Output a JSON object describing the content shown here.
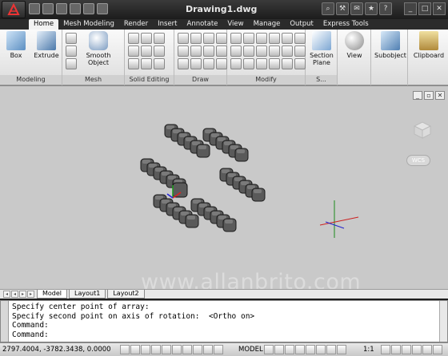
{
  "title": "Drawing1.dwg",
  "ribbon_tabs": [
    "Home",
    "Mesh Modeling",
    "Render",
    "Insert",
    "Annotate",
    "View",
    "Manage",
    "Output",
    "Express Tools"
  ],
  "ribbon": {
    "box_label": "Box",
    "extrude_label": "Extrude",
    "smooth_label": "Smooth Object",
    "section_label": "Section Plane",
    "view_label": "View",
    "subobject_label": "Subobject",
    "clipboard_label": "Clipboard",
    "groups": {
      "modeling": "Modeling",
      "mesh": "Mesh",
      "solid_editing": "Solid Editing",
      "draw": "Draw",
      "modify": "Modify",
      "section": "S..."
    }
  },
  "viewport": {
    "wcs_label": "WCS",
    "watermark": "www.allanbrito.com"
  },
  "layout_tabs": [
    "Model",
    "Layout1",
    "Layout2"
  ],
  "command_lines": [
    "Specify center point of array:",
    "Specify second point on axis of rotation:  <Ortho on>",
    "Command:",
    "Command:"
  ],
  "status": {
    "coords": "2797.4004, -3782.3438, 0.0000",
    "model_label": "MODEL",
    "scale": "1:1"
  },
  "colors": {
    "viewport_bg": "#c9c9c9",
    "cube_fill": "#5a5a5a",
    "cube_top": "#7a7a7a",
    "tab_active": "#f2f2f2"
  }
}
